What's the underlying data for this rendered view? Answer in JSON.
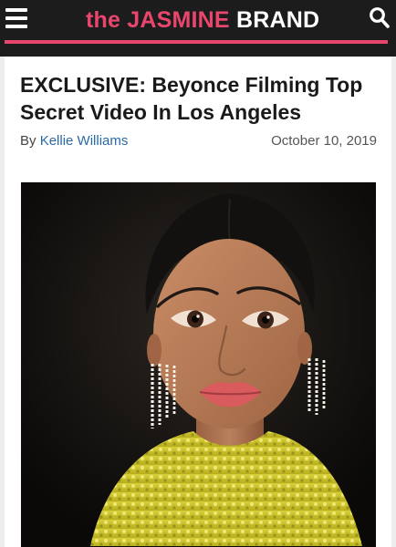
{
  "header": {
    "logo_prefix": "the ",
    "logo_highlight": "JASMINE",
    "logo_suffix": " BRAND",
    "menu_icon": "hamburger-menu-icon",
    "search_icon": "search-icon",
    "bg_color": "#1c1c1c",
    "accent_color": "#e8466d"
  },
  "article": {
    "headline": "EXCLUSIVE: Beyonce Filming Top Secret Video In Los Angeles",
    "byline_prefix": "By ",
    "author": "Kellie Williams",
    "date": "October 10, 2019",
    "link_color": "#2a6aa8"
  }
}
